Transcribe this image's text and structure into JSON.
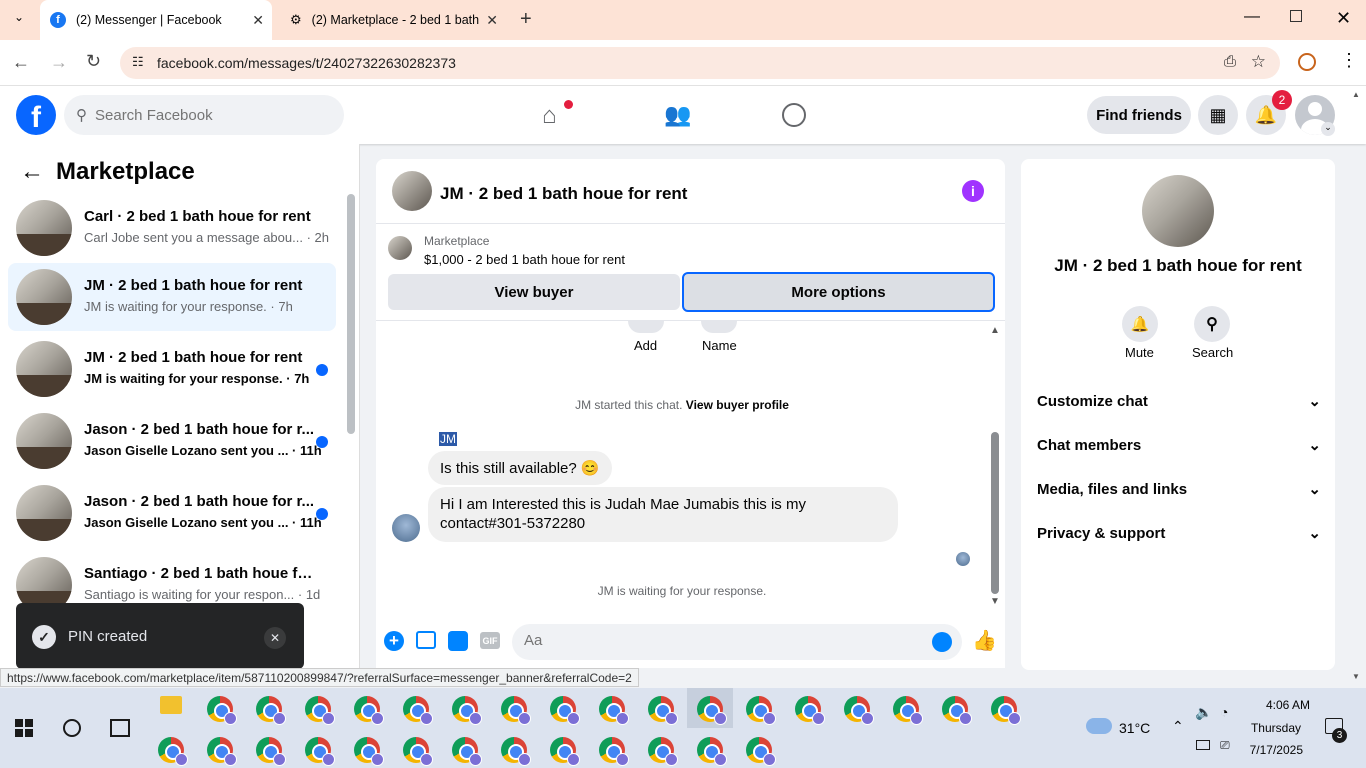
{
  "browser": {
    "tabs": [
      {
        "title": "(2) Messenger | Facebook"
      },
      {
        "title": "(2) Marketplace - 2 bed 1 bath "
      }
    ],
    "url": "facebook.com/messages/t/24027322630282373",
    "status_url": "https://www.facebook.com/marketplace/item/587110200899847/?referralSurface=messenger_banner&referralCode=2"
  },
  "fb_header": {
    "search_placeholder": "Search Facebook",
    "find_friends": "Find friends",
    "notification_count": "2"
  },
  "sidebar": {
    "title": "Marketplace",
    "conversations": [
      {
        "title": "Carl · 2 bed 1 bath houe for rent",
        "snippet": "Carl Jobe sent you a message abou... · 2h",
        "unread": false,
        "selected": false
      },
      {
        "title": "JM · 2 bed 1 bath houe for rent",
        "snippet": "JM is waiting for your response. · 7h",
        "unread": false,
        "selected": true
      },
      {
        "title": "JM · 2 bed 1 bath houe for rent",
        "snippet": "JM is waiting for your response. · 7h",
        "unread": true,
        "selected": false
      },
      {
        "title": "Jason · 2 bed 1 bath houe for r...",
        "snippet": "Jason Giselle Lozano sent you ... · 11h",
        "unread": true,
        "selected": false
      },
      {
        "title": "Jason · 2 bed 1 bath houe for r...",
        "snippet": "Jason Giselle Lozano sent you ... · 11h",
        "unread": true,
        "selected": false
      },
      {
        "title": "Santiago · 2 bed 1 bath houe for...",
        "snippet": "Santiago is waiting for your respon... · 1d",
        "unread": false,
        "selected": false
      }
    ]
  },
  "toast": {
    "text": "PIN created"
  },
  "chat": {
    "title": "JM · 2 bed 1 bath houe for rent",
    "listing_label": "Marketplace",
    "listing_price_title": "$1,000 - 2 bed 1 bath houe for rent",
    "view_buyer": "View buyer",
    "more_options": "More options",
    "action_add": "Add",
    "action_name": "Name",
    "started_text": "JM started this chat.",
    "view_buyer_profile": "View buyer profile",
    "sender_label": "JM",
    "messages": [
      "Is this still available? 😊",
      "Hi I am Interested this is Judah Mae Jumabis this is my contact#301-5372280"
    ],
    "waiting_text": "JM is waiting for your response.",
    "composer_placeholder": "Aa"
  },
  "info_panel": {
    "title": "JM · 2 bed 1 bath houe for rent",
    "mute": "Mute",
    "search": "Search",
    "sections": [
      "Customize chat",
      "Chat members",
      "Media, files and links",
      "Privacy & support"
    ]
  },
  "taskbar": {
    "temperature": "31°C",
    "time": "4:06 AM",
    "day": "Thursday",
    "date": "7/17/2025",
    "notif_count": "3"
  },
  "colors": {
    "fb_blue": "#0866ff",
    "messenger_blue": "#0084ff",
    "info_purple": "#a033ff"
  }
}
